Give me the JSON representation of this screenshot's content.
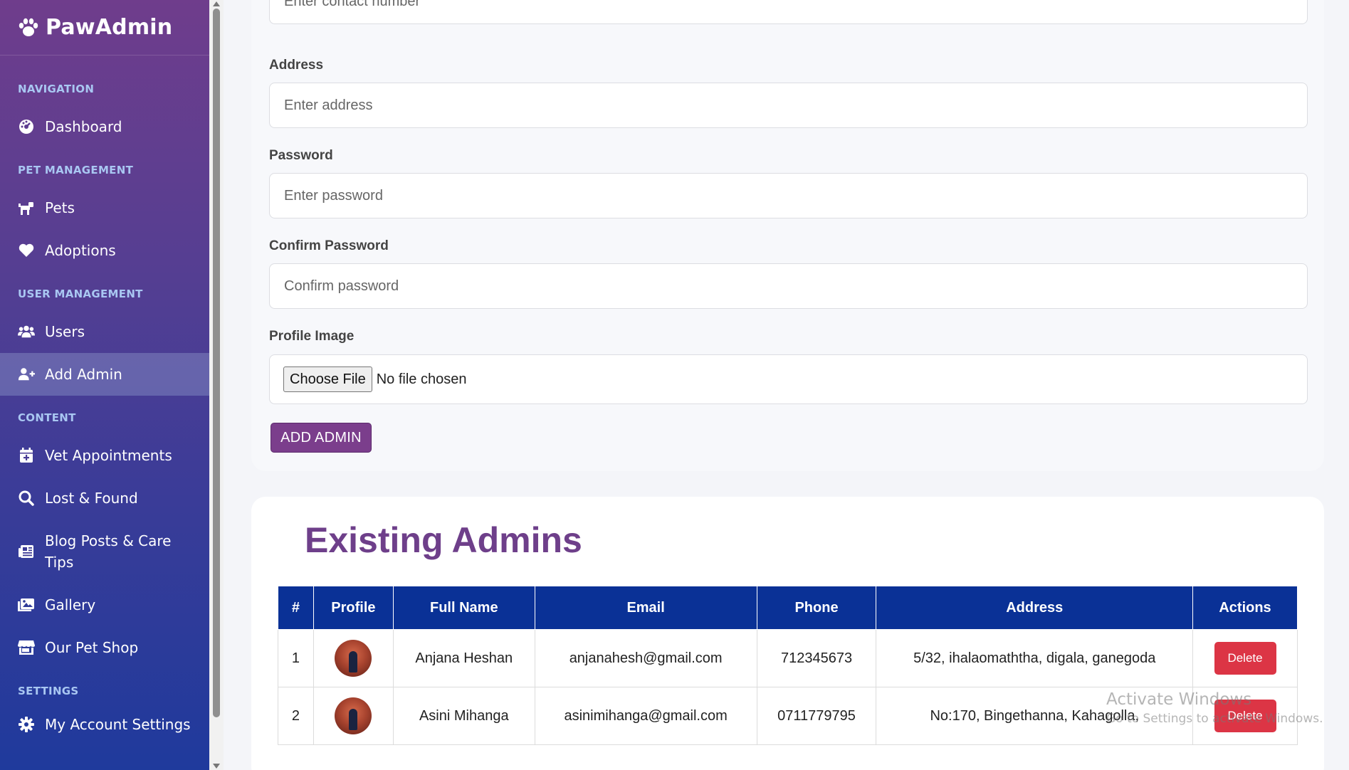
{
  "sidebar": {
    "brand": "PawAdmin",
    "sections": {
      "navigation": "NAVIGATION",
      "pet_management": "PET MANAGEMENT",
      "user_management": "USER MANAGEMENT",
      "content": "CONTENT",
      "settings": "SETTINGS"
    },
    "items": {
      "dashboard": "Dashboard",
      "pets": "Pets",
      "adoptions": "Adoptions",
      "users": "Users",
      "add_admin": "Add Admin",
      "vet_appointments": "Vet Appointments",
      "lost_found": "Lost & Found",
      "blog_line1": "Blog Posts & Care",
      "blog_line2": "Tips",
      "gallery": "Gallery",
      "pet_shop": "Our Pet Shop",
      "account_settings": "My Account Settings"
    },
    "active_item": "Add Admin",
    "colors": {
      "gradient_top": "#6f3d8c",
      "gradient_bottom": "#1f3a9c"
    }
  },
  "form": {
    "contact": {
      "placeholder": "Enter contact number"
    },
    "address": {
      "label": "Address",
      "placeholder": "Enter address"
    },
    "password": {
      "label": "Password",
      "placeholder": "Enter password"
    },
    "confirm_password": {
      "label": "Confirm Password",
      "placeholder": "Confirm password"
    },
    "profile_image": {
      "label": "Profile Image",
      "button": "Choose File",
      "status": "No file chosen"
    },
    "submit_label": "ADD ADMIN",
    "accent_color": "#7b3e8c"
  },
  "admins": {
    "title": "Existing Admins",
    "columns": [
      "#",
      "Profile",
      "Full Name",
      "Email",
      "Phone",
      "Address",
      "Actions"
    ],
    "rows": [
      {
        "num": "1",
        "name": "Anjana Heshan",
        "email": "anjanahesh@gmail.com",
        "phone": "712345673",
        "address": "5/32, ihalaomaththa, digala, ganegoda",
        "action": "Delete"
      },
      {
        "num": "2",
        "name": "Asini Mihanga",
        "email": "asinimihanga@gmail.com",
        "phone": "0711779795",
        "address": "No:170, Bingethanna, Kahagolla,",
        "action": "Delete"
      }
    ],
    "header_color": "#0a3196",
    "delete_color": "#dc3545"
  },
  "watermark": {
    "line1": "Activate Windows",
    "line2": "Go to Settings to activate Windows."
  }
}
